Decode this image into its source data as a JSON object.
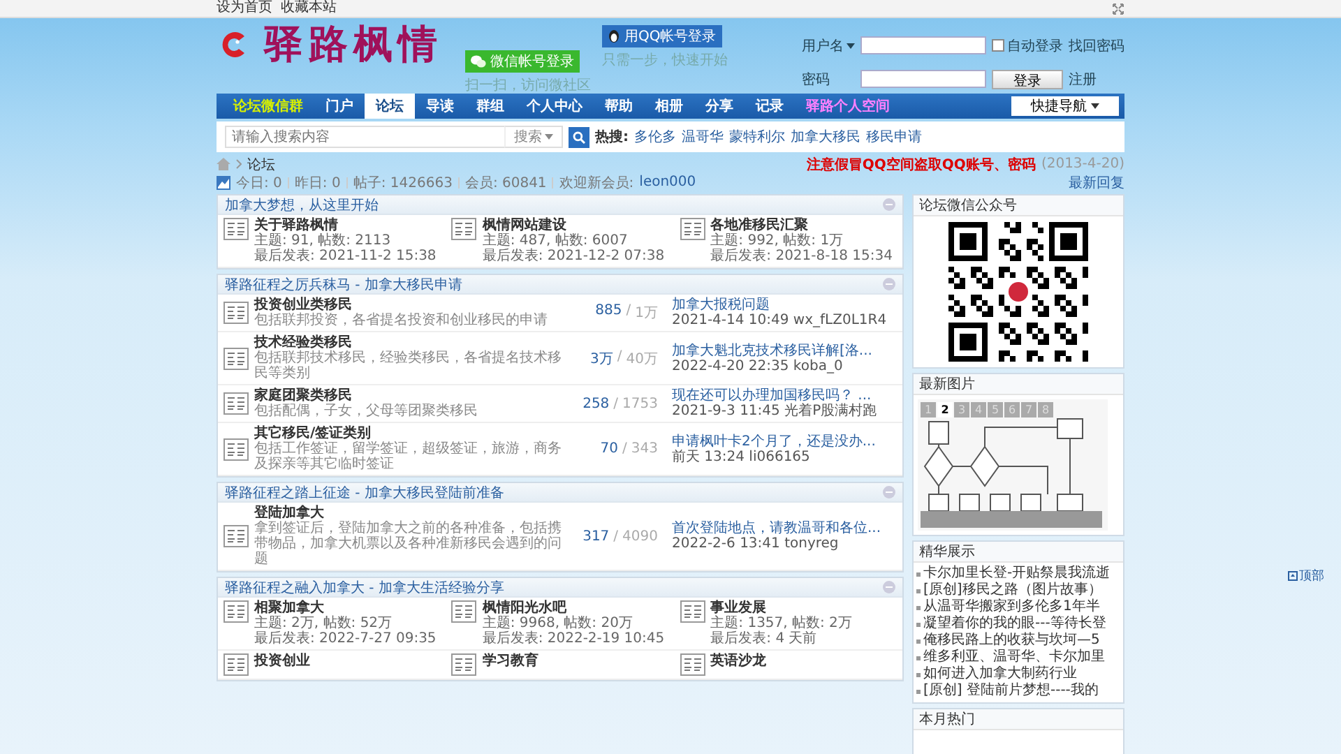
{
  "top_links": [
    "设为首页",
    "收藏本站"
  ],
  "header": {
    "logo_text": "驿路枫情",
    "qq_button": "用QQ帐号登录",
    "qq_hint": "只需一步，快速开始",
    "wechat_button": "微信帐号登录",
    "wechat_hint": "扫一扫，访问微社区",
    "login": {
      "username_label": "用户名",
      "password_label": "密码",
      "auto_login": {
        "label": "自动登录",
        "checked": false
      },
      "forgot": "找回密码",
      "submit": "登录",
      "register": "注册"
    }
  },
  "nav": {
    "items": [
      {
        "label": "论坛微信群",
        "selected": false,
        "kind": "wechat"
      },
      {
        "label": "门户",
        "selected": false,
        "kind": "plain"
      },
      {
        "label": "论坛",
        "selected": true,
        "kind": "plain"
      },
      {
        "label": "导读",
        "selected": false,
        "kind": "plain"
      },
      {
        "label": "群组",
        "selected": false,
        "kind": "plain"
      },
      {
        "label": "个人中心",
        "selected": false,
        "kind": "plain"
      },
      {
        "label": "帮助",
        "selected": false,
        "kind": "plain"
      },
      {
        "label": "相册",
        "selected": false,
        "kind": "plain"
      },
      {
        "label": "分享",
        "selected": false,
        "kind": "plain"
      },
      {
        "label": "记录",
        "selected": false,
        "kind": "plain"
      },
      {
        "label": "驿路个人空间",
        "selected": false,
        "kind": "personal"
      }
    ],
    "quick": "快捷导航"
  },
  "search": {
    "placeholder": "请输入搜索内容",
    "scope": "搜索",
    "hot_label": "热搜:",
    "hot": [
      "多伦多",
      "温哥华",
      "蒙特利尔",
      "加拿大移民",
      "移民申请"
    ]
  },
  "breadcrumb": {
    "current": "论坛",
    "notice": "注意假冒QQ空间盗取QQ账号、密码",
    "notice_date": "(2013-4-20)"
  },
  "stats": {
    "items": [
      "今日: 0",
      "昨日: 0",
      "帖子: 1426663",
      "会员: 60841"
    ],
    "welcome": "欢迎新会员:",
    "new_member": "leon000",
    "latest": "最新回复"
  },
  "sections": [
    {
      "title": "加拿大梦想，从这里开始",
      "kind": "grid",
      "forums": [
        {
          "name": "关于驿路枫情",
          "stats": "主题: 91, 帖数: 2113",
          "last": "最后发表: 2021-11-2 15:38"
        },
        {
          "name": "枫情网站建设",
          "stats": "主题: 487, 帖数: 6007",
          "last": "最后发表: 2021-12-2 07:38"
        },
        {
          "name": "各地准移民汇聚",
          "stats": "主题: 992, 帖数: 1万",
          "last": "最后发表: 2021-8-18 15:34"
        }
      ]
    },
    {
      "title": "驿路征程之厉兵秣马 - 加拿大移民申请",
      "kind": "list",
      "forums": [
        {
          "name": "投资创业类移民",
          "desc": "包括联邦投资，各省提名投资和创业移民的申请",
          "threads": "885",
          "posts": "1万",
          "last_title": "加拿大报税问题",
          "last_info": "2021-4-14 10:49 wx_fLZ0L1R4"
        },
        {
          "name": "技术经验类移民",
          "desc": "包括联邦技术移民，经验类移民，各省提名技术移民等类别",
          "threads": "3万",
          "posts": "40万",
          "last_title": "加拿大魁北克技术移民详解[洛...",
          "last_info": "2022-4-20 22:35 koba_0"
        },
        {
          "name": "家庭团聚类移民",
          "desc": "包括配偶，子女，父母等团聚类移民",
          "threads": "258",
          "posts": "1753",
          "last_title": "现在还可以办理加国移民吗？ ...",
          "last_info": "2021-9-3 11:45 光着P股满村跑"
        },
        {
          "name": "其它移民/签证类别",
          "desc": "包括工作签证，留学签证，超级签证，旅游，商务及探亲等其它临时签证",
          "threads": "70",
          "posts": "343",
          "last_title": "申请枫叶卡2个月了，还是没办...",
          "last_info": "前天 13:24 li066165"
        }
      ]
    },
    {
      "title": "驿路征程之踏上征途 - 加拿大移民登陆前准备",
      "kind": "list",
      "forums": [
        {
          "name": "登陆加拿大",
          "desc": "拿到签证后，登陆加拿大之前的各种准备，包括携带物品，加拿大机票以及各种准新移民会遇到的问题",
          "threads": "317",
          "posts": "4090",
          "last_title": "首次登陆地点，请教温哥和各位...",
          "last_info": "2022-2-6 13:41 tonyreg"
        }
      ]
    },
    {
      "title": "驿路征程之融入加拿大 - 加拿大生活经验分享",
      "kind": "grid",
      "forums": [
        {
          "name": "相聚加拿大",
          "stats": "主题: 2万, 帖数: 52万",
          "last": "最后发表: 2022-7-27 09:35"
        },
        {
          "name": "枫情阳光水吧",
          "stats": "主题: 9968, 帖数: 20万",
          "last": "最后发表: 2022-2-19 10:45"
        },
        {
          "name": "事业发展",
          "stats": "主题: 1357, 帖数: 2万",
          "last": "最后发表: 4 天前"
        },
        {
          "name": "投资创业"
        },
        {
          "name": "学习教育"
        },
        {
          "name": "英语沙龙"
        }
      ]
    }
  ],
  "sidebar": {
    "wechat_title": "论坛微信公众号",
    "photos_title": "最新图片",
    "pager": [
      {
        "label": "1",
        "selected": false
      },
      {
        "label": "2",
        "selected": true
      },
      {
        "label": "3",
        "selected": false
      },
      {
        "label": "4",
        "selected": false
      },
      {
        "label": "5",
        "selected": false
      },
      {
        "label": "6",
        "selected": false
      },
      {
        "label": "7",
        "selected": false
      },
      {
        "label": "8",
        "selected": false
      }
    ],
    "featured_title": "精华展示",
    "featured": [
      "卡尔加里长登-开贴祭晨我流逝",
      "[原创]移民之路（图片故事）",
      "从温哥华搬家到多伦多1年半",
      "凝望着你的我的眼---等待长登",
      "俺移民路上的收获与坎坷—5",
      "维多利亚、温哥华、卡尔加里",
      "如何进入加拿大制药行业",
      "[原创] 登陆前片梦想----我的"
    ],
    "hot_title": "本月热门"
  },
  "count_separator": "/",
  "back_top": "顶部"
}
